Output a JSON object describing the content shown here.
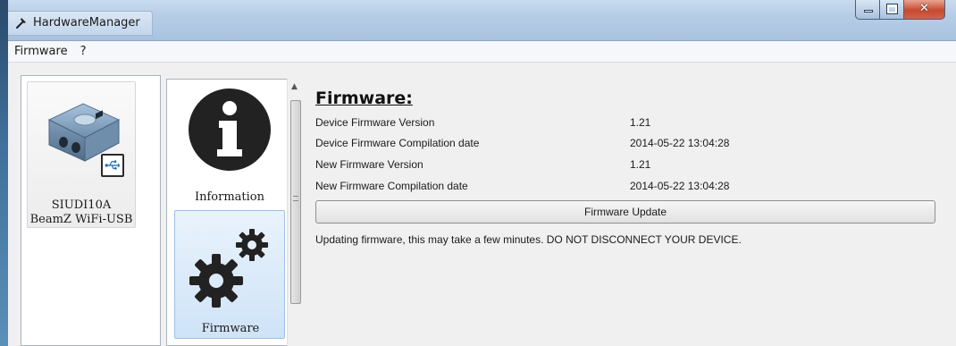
{
  "window": {
    "title": "HardwareManager",
    "icon": "hammer-icon"
  },
  "menu": [
    {
      "label": "Firmware"
    },
    {
      "label": "?"
    }
  ],
  "device": {
    "name": "SIUDI10A",
    "subtitle": "BeamZ WiFi-USB",
    "connection_icon": "usb-icon"
  },
  "nav": {
    "items": [
      {
        "label": "Information",
        "icon": "info-icon",
        "selected": false
      },
      {
        "label": "Firmware",
        "icon": "gears-icon",
        "selected": true
      }
    ]
  },
  "firmware": {
    "title": "Firmware:",
    "rows": [
      {
        "label": "Device Firmware Version",
        "value": "1.21"
      },
      {
        "label": "Device Firmware Compilation date",
        "value": "2014-05-22 13:04:28"
      },
      {
        "label": "New Firmware Version",
        "value": "1.21"
      },
      {
        "label": "New Firmware Compilation date",
        "value": "2014-05-22 13:04:28"
      }
    ],
    "update_button": "Firmware Update",
    "warning": "Updating firmware, this may take a few minutes. DO NOT DISCONNECT YOUR DEVICE."
  },
  "colors": {
    "titlebar": "#b6cde6",
    "close_button": "#c74a2e",
    "selected_nav": "#cfe3f7"
  }
}
